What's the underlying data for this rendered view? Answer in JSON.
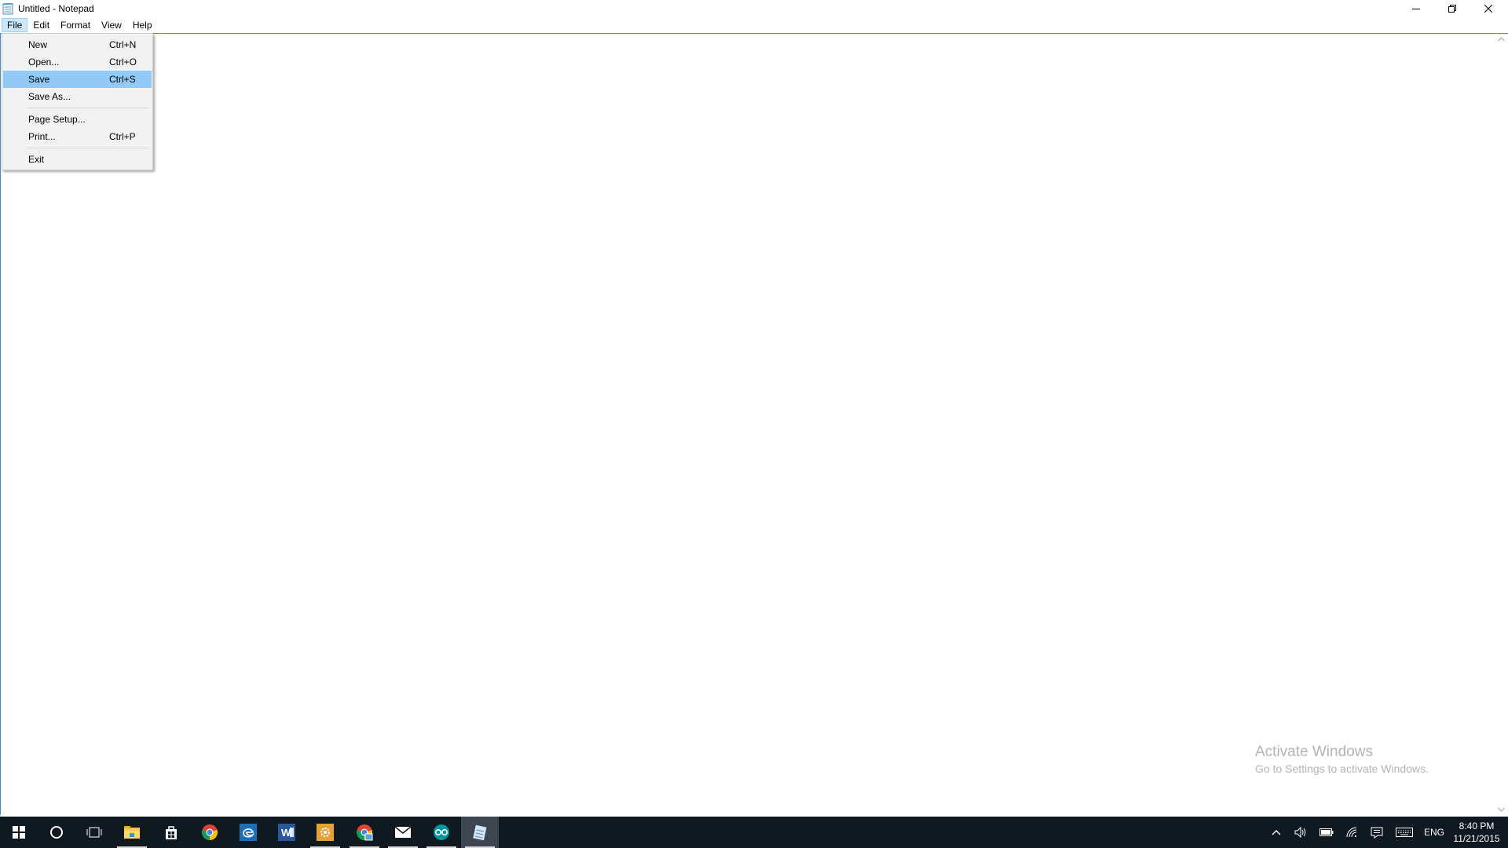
{
  "window": {
    "title": "Untitled - Notepad"
  },
  "menubar": {
    "items": [
      "File",
      "Edit",
      "Format",
      "View",
      "Help"
    ],
    "active": "File"
  },
  "file_menu": {
    "items": [
      {
        "label": "New",
        "shortcut": "Ctrl+N"
      },
      {
        "label": "Open...",
        "shortcut": "Ctrl+O"
      },
      {
        "label": "Save",
        "shortcut": "Ctrl+S",
        "highlighted": true
      },
      {
        "label": "Save As...",
        "shortcut": ""
      },
      {
        "label": "Page Setup...",
        "shortcut": ""
      },
      {
        "label": "Print...",
        "shortcut": "Ctrl+P"
      },
      {
        "label": "Exit",
        "shortcut": ""
      }
    ]
  },
  "editor": {
    "content": ""
  },
  "watermark": {
    "title": "Activate Windows",
    "subtitle": "Go to Settings to activate Windows."
  },
  "taskbar": {
    "apps": [
      "start-icon",
      "cortana-icon",
      "task-view-icon",
      "file-explorer-icon",
      "store-icon",
      "chrome-icon",
      "edge-icon",
      "word-icon",
      "settings-app-icon",
      "chrome-alt-icon",
      "mail-icon",
      "arduino-icon",
      "notepad-icon"
    ],
    "language": "ENG",
    "time": "8:40 PM",
    "date": "11/21/2015"
  },
  "colors": {
    "menu_highlight": "#91c9f7",
    "menubar_active": "#cce8ff",
    "taskbar": "#101820",
    "accent": "#3b8fd6"
  }
}
